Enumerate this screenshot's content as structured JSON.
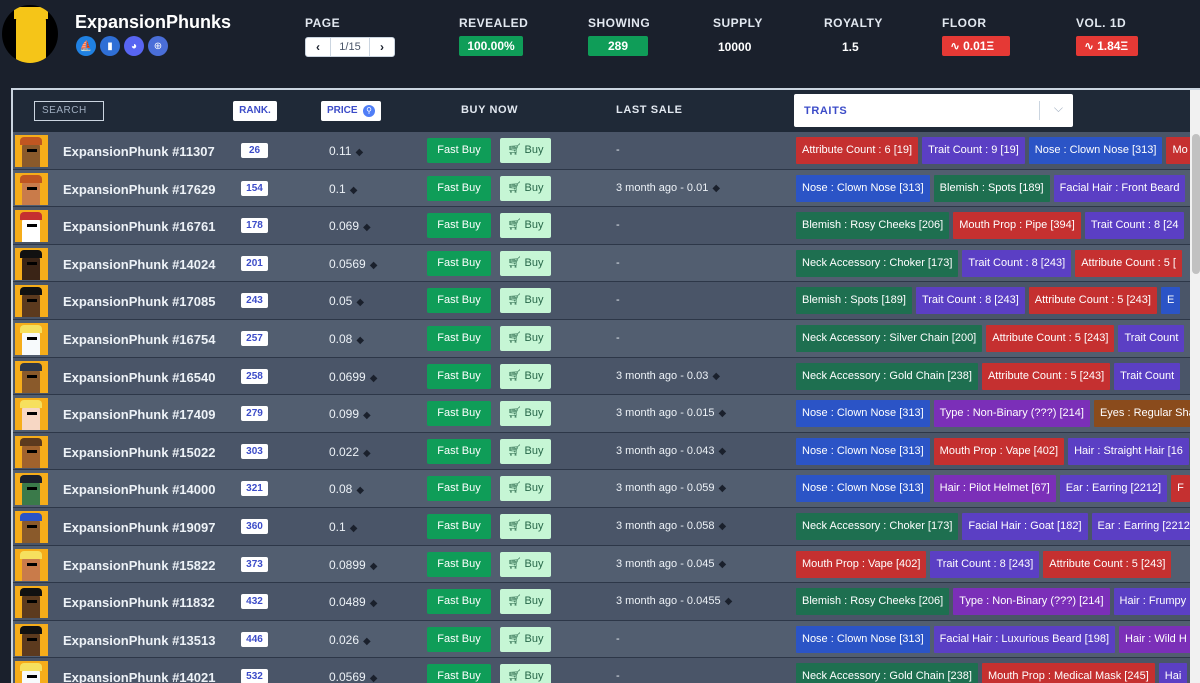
{
  "brand": {
    "name": "ExpansionPhunks",
    "socials": [
      {
        "icon": "opensea-icon",
        "glyph": "⛵",
        "color": "#2081e2"
      },
      {
        "icon": "stats-icon",
        "glyph": "▮",
        "color": "#2f6fd6"
      },
      {
        "icon": "discord-icon",
        "glyph": "◕",
        "color": "#5865f2"
      },
      {
        "icon": "globe-icon",
        "glyph": "⊕",
        "color": "#4a6ed8"
      }
    ]
  },
  "stats": {
    "page_label": "PAGE",
    "page_value": "1/15",
    "revealed_label": "REVEALED",
    "revealed_value": "100.00%",
    "showing_label": "SHOWING",
    "showing_value": "289",
    "supply_label": "SUPPLY",
    "supply_value": "10000",
    "royalty_label": "ROYALTY",
    "royalty_value": "1.5",
    "floor_label": "FLOOR",
    "floor_value": "0.01Ξ",
    "vol_label": "VOL. 1D",
    "vol_value": "1.84Ξ"
  },
  "table": {
    "search_placeholder": "SEARCH",
    "rank_label": "RANK.",
    "price_label": "PRICE",
    "buy_now_label": "BUY NOW",
    "last_sale_label": "LAST SALE",
    "traits_label": "TRAITS",
    "fast_buy_label": "Fast Buy",
    "buy_label": "Buy",
    "eth_glyph": "◆"
  },
  "rows": [
    {
      "name": "ExpansionPhunk #11307",
      "rank": "26",
      "price": "0.11",
      "last": "-",
      "skin": "#8a5a2b",
      "hair": "#c05621",
      "traits": [
        {
          "t": "Attribute Count : 6 [19]",
          "c": "c-red"
        },
        {
          "t": "Trait Count : 9 [19]",
          "c": "c-purple"
        },
        {
          "t": "Nose : Clown Nose [313]",
          "c": "c-blue"
        },
        {
          "t": "Mo",
          "c": "c-red"
        }
      ]
    },
    {
      "name": "ExpansionPhunk #17629",
      "rank": "154",
      "price": "0.1",
      "last": "3 month ago - 0.01",
      "skin": "#c97b4a",
      "hair": "#c05621",
      "traits": [
        {
          "t": "Nose : Clown Nose [313]",
          "c": "c-blue"
        },
        {
          "t": "Blemish : Spots [189]",
          "c": "c-green"
        },
        {
          "t": "Facial Hair : Front Beard",
          "c": "c-purple"
        }
      ]
    },
    {
      "name": "ExpansionPhunk #16761",
      "rank": "178",
      "price": "0.069",
      "last": "-",
      "skin": "#ffffff",
      "hair": "#c53030",
      "traits": [
        {
          "t": "Blemish : Rosy Cheeks [206]",
          "c": "c-green"
        },
        {
          "t": "Mouth Prop : Pipe [394]",
          "c": "c-red"
        },
        {
          "t": "Trait Count : 8 [24",
          "c": "c-purple"
        }
      ]
    },
    {
      "name": "ExpansionPhunk #14024",
      "rank": "201",
      "price": "0.0569",
      "last": "-",
      "skin": "#3a2416",
      "hair": "#111111",
      "traits": [
        {
          "t": "Neck Accessory : Choker [173]",
          "c": "c-green"
        },
        {
          "t": "Trait Count : 8 [243]",
          "c": "c-purple"
        },
        {
          "t": "Attribute Count : 5 [",
          "c": "c-red"
        }
      ]
    },
    {
      "name": "ExpansionPhunk #17085",
      "rank": "243",
      "price": "0.05",
      "last": "-",
      "skin": "#5c3a1e",
      "hair": "#111111",
      "traits": [
        {
          "t": "Blemish : Spots [189]",
          "c": "c-green"
        },
        {
          "t": "Trait Count : 8 [243]",
          "c": "c-purple"
        },
        {
          "t": "Attribute Count : 5 [243]",
          "c": "c-red"
        },
        {
          "t": "E",
          "c": "c-blue"
        }
      ]
    },
    {
      "name": "ExpansionPhunk #16754",
      "rank": "257",
      "price": "0.08",
      "last": "-",
      "skin": "#f7fafc",
      "hair": "#f6e05e",
      "traits": [
        {
          "t": "Neck Accessory : Silver Chain [200]",
          "c": "c-green"
        },
        {
          "t": "Attribute Count : 5 [243]",
          "c": "c-red"
        },
        {
          "t": "Trait Count",
          "c": "c-purple"
        }
      ]
    },
    {
      "name": "ExpansionPhunk #16540",
      "rank": "258",
      "price": "0.0699",
      "last": "3 month ago - 0.03",
      "skin": "#8a5a2b",
      "hair": "#2d3748",
      "traits": [
        {
          "t": "Neck Accessory : Gold Chain [238]",
          "c": "c-green"
        },
        {
          "t": "Attribute Count : 5 [243]",
          "c": "c-red"
        },
        {
          "t": "Trait Count",
          "c": "c-purple"
        }
      ]
    },
    {
      "name": "ExpansionPhunk #17409",
      "rank": "279",
      "price": "0.099",
      "last": "3 month ago - 0.015",
      "skin": "#f7d7c4",
      "hair": "#f6e05e",
      "traits": [
        {
          "t": "Nose : Clown Nose [313]",
          "c": "c-blue"
        },
        {
          "t": "Type : Non-Binary (???) [214]",
          "c": "c-violet"
        },
        {
          "t": "Eyes : Regular Sha",
          "c": "c-brown"
        }
      ]
    },
    {
      "name": "ExpansionPhunk #15022",
      "rank": "303",
      "price": "0.022",
      "last": "3 month ago - 0.043",
      "skin": "#a0622d",
      "hair": "#5c3a1e",
      "traits": [
        {
          "t": "Nose : Clown Nose [313]",
          "c": "c-blue"
        },
        {
          "t": "Mouth Prop : Vape [402]",
          "c": "c-red"
        },
        {
          "t": "Hair : Straight Hair [16",
          "c": "c-purple"
        }
      ]
    },
    {
      "name": "ExpansionPhunk #14000",
      "rank": "321",
      "price": "0.08",
      "last": "3 month ago - 0.059",
      "skin": "#3a7a4a",
      "hair": "#1a202c",
      "traits": [
        {
          "t": "Nose : Clown Nose [313]",
          "c": "c-blue"
        },
        {
          "t": "Hair : Pilot Helmet [67]",
          "c": "c-violet"
        },
        {
          "t": "Ear : Earring [2212]",
          "c": "c-purple"
        },
        {
          "t": "F",
          "c": "c-red"
        }
      ]
    },
    {
      "name": "ExpansionPhunk #19097",
      "rank": "360",
      "price": "0.1",
      "last": "3 month ago - 0.058",
      "skin": "#8a5a2b",
      "hair": "#2b54c6",
      "traits": [
        {
          "t": "Neck Accessory : Choker [173]",
          "c": "c-green"
        },
        {
          "t": "Facial Hair : Goat [182]",
          "c": "c-purple"
        },
        {
          "t": "Ear : Earring [2212",
          "c": "c-purple"
        }
      ]
    },
    {
      "name": "ExpansionPhunk #15822",
      "rank": "373",
      "price": "0.0899",
      "last": "3 month ago - 0.045",
      "skin": "#c97b4a",
      "hair": "#f6e05e",
      "traits": [
        {
          "t": "Mouth Prop : Vape [402]",
          "c": "c-red"
        },
        {
          "t": "Trait Count : 8 [243]",
          "c": "c-purple"
        },
        {
          "t": "Attribute Count : 5 [243]",
          "c": "c-red"
        }
      ]
    },
    {
      "name": "ExpansionPhunk #11832",
      "rank": "432",
      "price": "0.0489",
      "last": "3 month ago - 0.0455",
      "skin": "#5c3a1e",
      "hair": "#111111",
      "traits": [
        {
          "t": "Blemish : Rosy Cheeks [206]",
          "c": "c-green"
        },
        {
          "t": "Type : Non-Binary (???) [214]",
          "c": "c-violet"
        },
        {
          "t": "Hair : Frumpy",
          "c": "c-purple"
        }
      ]
    },
    {
      "name": "ExpansionPhunk #13513",
      "rank": "446",
      "price": "0.026",
      "last": "-",
      "skin": "#5c3a1e",
      "hair": "#111111",
      "traits": [
        {
          "t": "Nose : Clown Nose [313]",
          "c": "c-blue"
        },
        {
          "t": "Facial Hair : Luxurious Beard [198]",
          "c": "c-purple"
        },
        {
          "t": "Hair : Wild H",
          "c": "c-violet"
        }
      ]
    },
    {
      "name": "ExpansionPhunk #14021",
      "rank": "532",
      "price": "0.0569",
      "last": "-",
      "skin": "#f7fafc",
      "hair": "#f6e05e",
      "traits": [
        {
          "t": "Neck Accessory : Gold Chain [238]",
          "c": "c-green"
        },
        {
          "t": "Mouth Prop : Medical Mask [245]",
          "c": "c-red"
        },
        {
          "t": "Hai",
          "c": "c-purple"
        }
      ]
    }
  ]
}
